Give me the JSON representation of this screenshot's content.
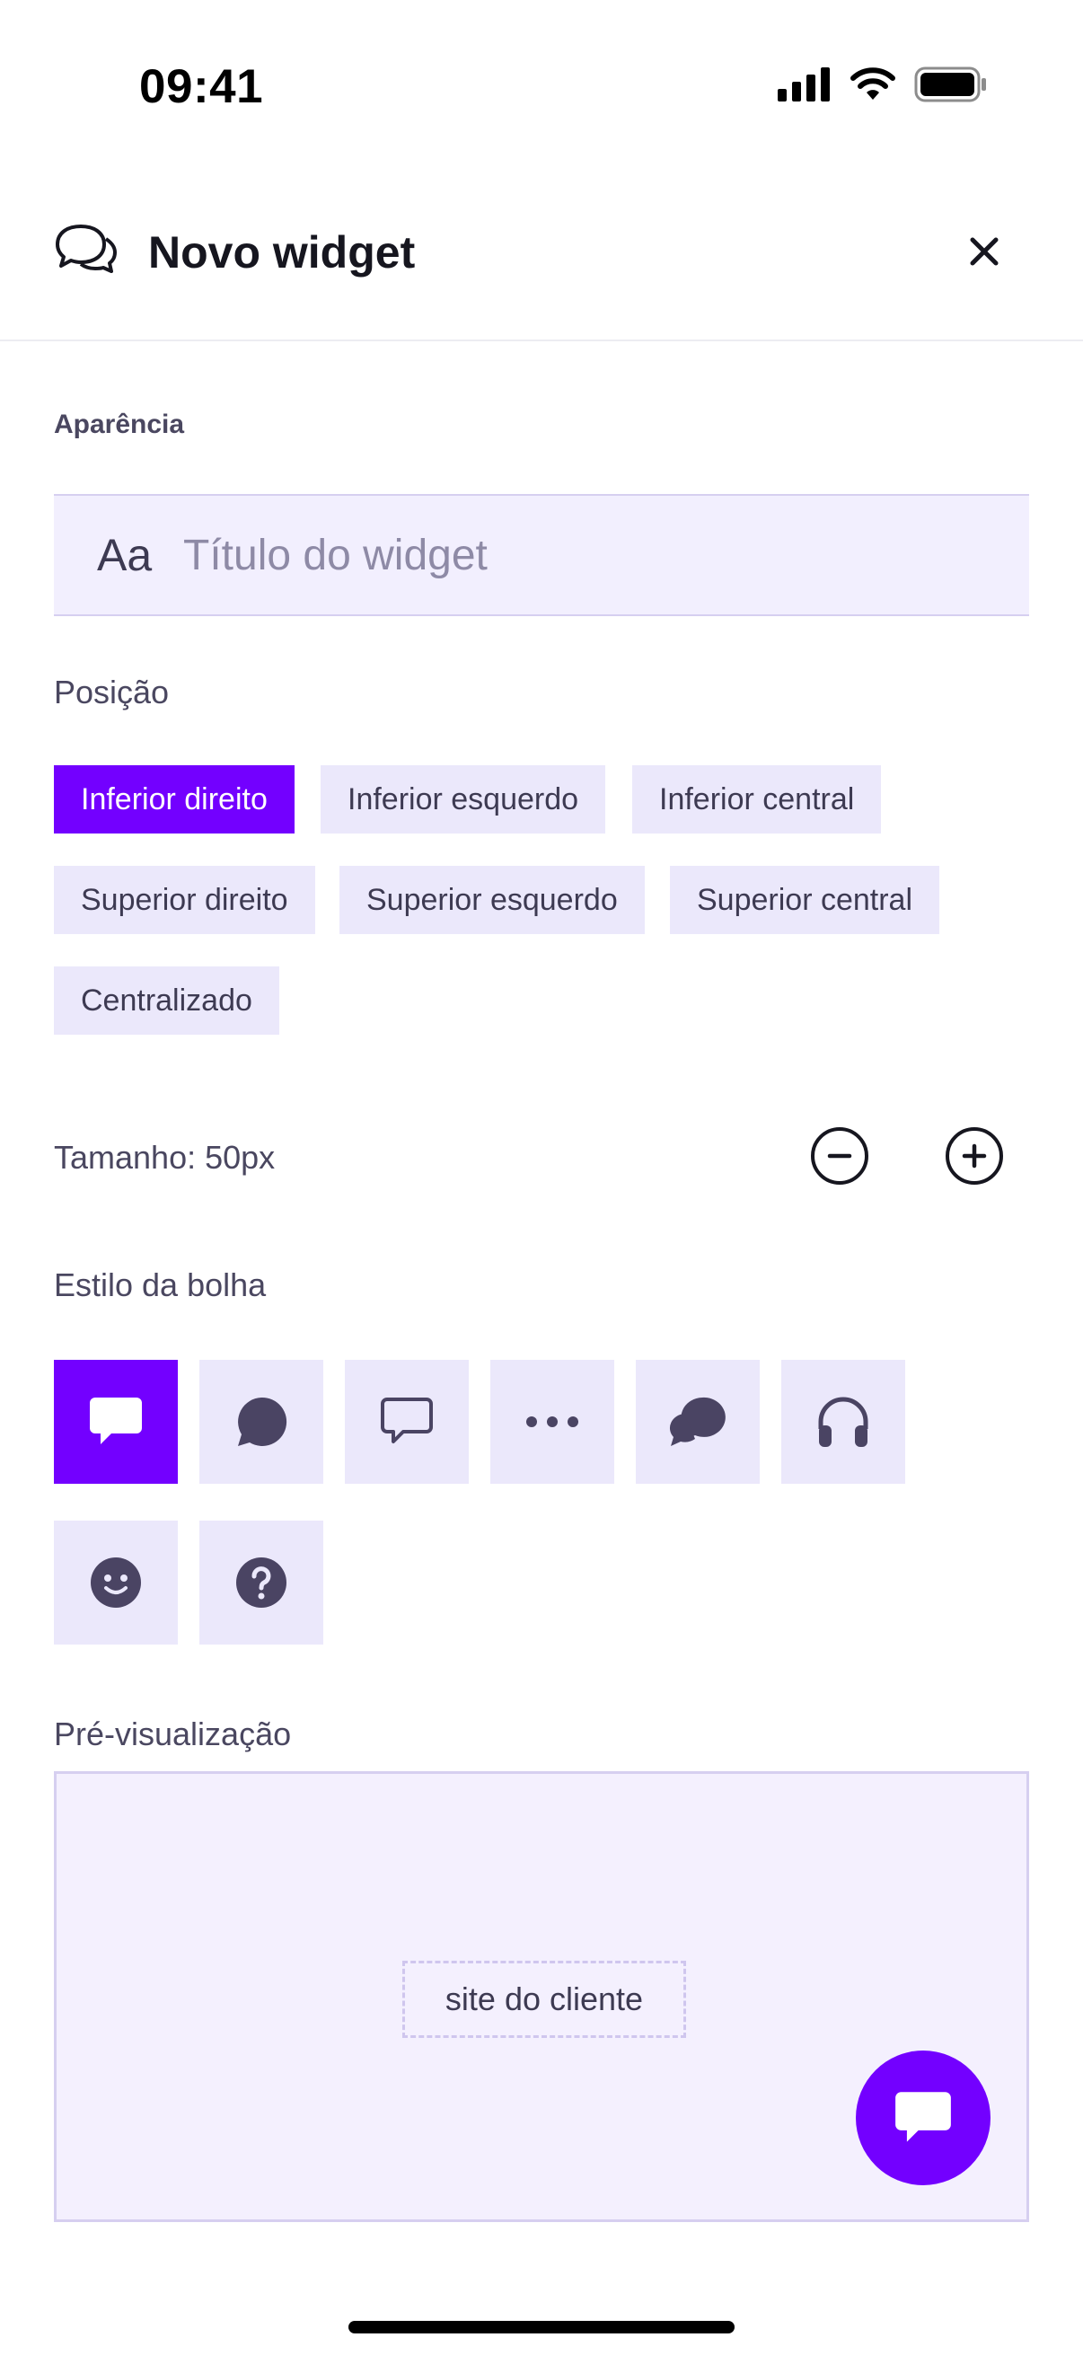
{
  "status_bar": {
    "time": "09:41"
  },
  "header": {
    "title": "Novo widget",
    "icon": "chat-bubbles-icon",
    "close_icon": "close-icon"
  },
  "appearance": {
    "section_label": "Aparência",
    "title_input": {
      "prefix": "Aa",
      "placeholder": "Título do widget",
      "value": ""
    }
  },
  "position": {
    "label": "Posição",
    "selected": "Inferior direito",
    "options": [
      "Inferior direito",
      "Inferior esquerdo",
      "Inferior central",
      "Superior direito",
      "Superior esquerdo",
      "Superior central",
      "Centralizado"
    ]
  },
  "size": {
    "label": "Tamanho: 50px",
    "decrease_icon": "minus-circle-icon",
    "increase_icon": "plus-circle-icon"
  },
  "bubble_style": {
    "label": "Estilo da bolha",
    "selected": "chat-square-icon",
    "options": [
      "chat-square-icon",
      "chat-round-icon",
      "chat-outline-icon",
      "dots-icon",
      "chat-double-icon",
      "headphones-icon",
      "smile-icon",
      "question-icon"
    ]
  },
  "preview": {
    "label": "Pré-visualização",
    "site_placeholder": "site do cliente"
  },
  "colors": {
    "accent": "#7300ff",
    "chip_bg": "#ebe8fb",
    "input_bg": "#f2effe",
    "preview_bg": "#f4f0fe",
    "text_muted": "#4a4760"
  }
}
